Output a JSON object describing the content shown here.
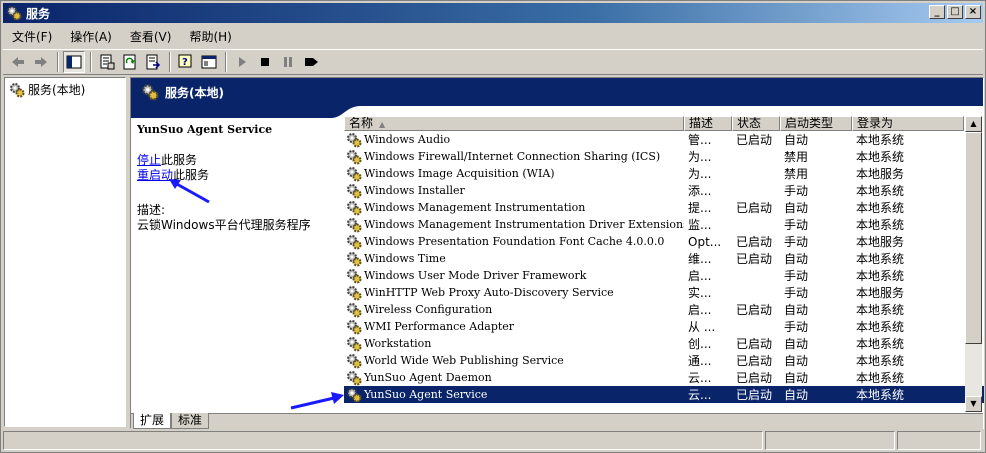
{
  "window": {
    "title": "服务",
    "min_label": "_",
    "max_label": "□",
    "close_label": "×"
  },
  "menu": {
    "items": [
      "文件(F)",
      "操作(A)",
      "查看(V)",
      "帮助(H)"
    ]
  },
  "toolbar": {
    "icons": [
      "back-arrow-icon",
      "forward-arrow-icon",
      "show-hide-tree-icon",
      "properties-icon",
      "refresh-icon",
      "export-list-icon",
      "help-icon",
      "console-icon",
      "start-service-icon",
      "stop-service-icon",
      "pause-service-icon",
      "restart-service-icon"
    ]
  },
  "tree": {
    "root_label": "服务(本地)"
  },
  "banner": {
    "title": "服务(本地)"
  },
  "details": {
    "service_name": "YunSuo Agent Service",
    "stop_link": "停止",
    "stop_suffix": "此服务",
    "restart_link": "重启动",
    "restart_suffix": "此服务",
    "desc_label": "描述:",
    "desc_text": "云锁Windows平台代理服务程序"
  },
  "list": {
    "columns": [
      "名称",
      "描述",
      "状态",
      "启动类型",
      "登录为"
    ],
    "rows": [
      [
        "Windows Audio",
        "管...",
        "已启动",
        "自动",
        "本地系统"
      ],
      [
        "Windows Firewall/Internet Connection Sharing (ICS)",
        "为...",
        "",
        "禁用",
        "本地系统"
      ],
      [
        "Windows Image Acquisition (WIA)",
        "为...",
        "",
        "禁用",
        "本地服务"
      ],
      [
        "Windows Installer",
        "添...",
        "",
        "手动",
        "本地系统"
      ],
      [
        "Windows Management Instrumentation",
        "提...",
        "已启动",
        "自动",
        "本地系统"
      ],
      [
        "Windows Management Instrumentation Driver Extensions",
        "监...",
        "",
        "手动",
        "本地系统"
      ],
      [
        "Windows Presentation Foundation Font Cache 4.0.0.0",
        "Opt...",
        "已启动",
        "手动",
        "本地服务"
      ],
      [
        "Windows Time",
        "维...",
        "已启动",
        "自动",
        "本地系统"
      ],
      [
        "Windows User Mode Driver Framework",
        "启...",
        "",
        "手动",
        "本地系统"
      ],
      [
        "WinHTTP Web Proxy Auto-Discovery Service",
        "实...",
        "",
        "手动",
        "本地服务"
      ],
      [
        "Wireless Configuration",
        "启...",
        "已启动",
        "自动",
        "本地系统"
      ],
      [
        "WMI Performance Adapter",
        "从 ...",
        "",
        "手动",
        "本地系统"
      ],
      [
        "Workstation",
        "创...",
        "已启动",
        "自动",
        "本地系统"
      ],
      [
        "World Wide Web Publishing Service",
        "通...",
        "已启动",
        "自动",
        "本地系统"
      ],
      [
        "YunSuo Agent Daemon",
        "云...",
        "已启动",
        "自动",
        "本地系统"
      ],
      [
        "YunSuo Agent Service",
        "云...",
        "已启动",
        "自动",
        "本地系统"
      ]
    ],
    "selected_index": 15
  },
  "tabs": [
    "扩展",
    "标准"
  ],
  "colors": {
    "selection": "#0a246a",
    "link": "#0000ee",
    "annotation_arrow": "#1a1aff"
  }
}
